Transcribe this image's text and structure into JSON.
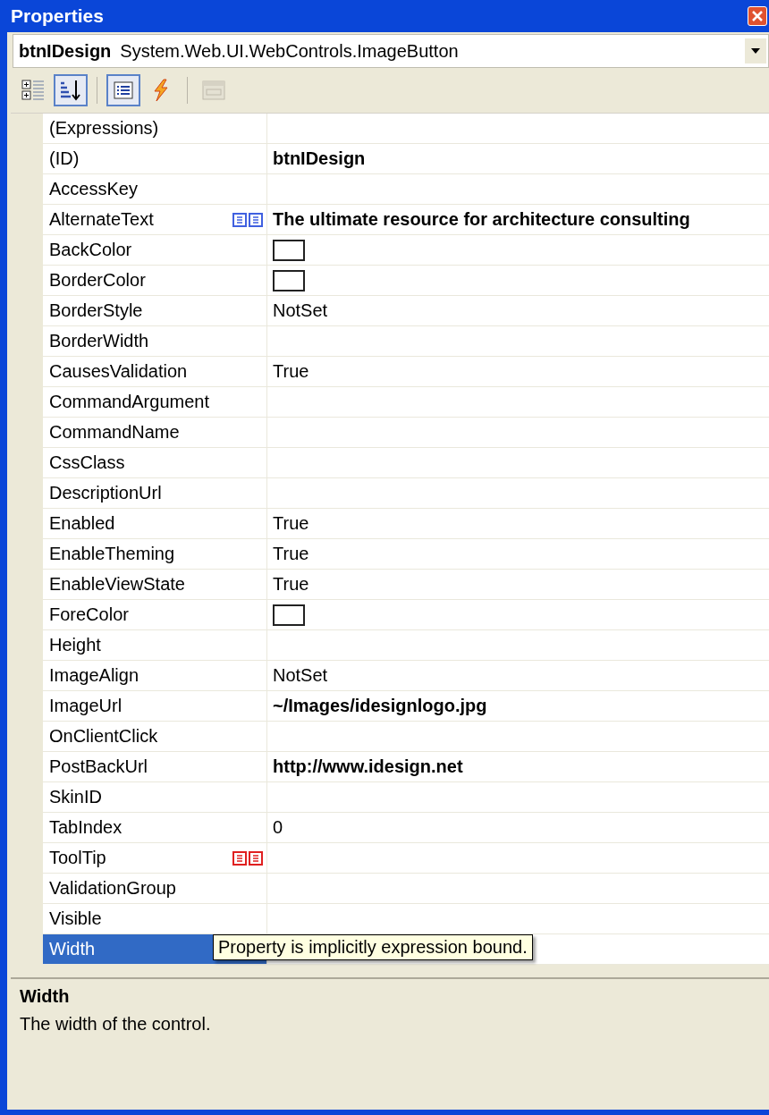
{
  "window": {
    "title": "Properties"
  },
  "object_selector": {
    "name": "btnIDesign",
    "type": "System.Web.UI.WebControls.ImageButton"
  },
  "toolbar": [
    {
      "kind": "categorized",
      "selected": false,
      "disabled": false
    },
    {
      "kind": "alphabetical",
      "selected": true,
      "disabled": false
    },
    {
      "kind": "separator"
    },
    {
      "kind": "properties",
      "selected": true,
      "disabled": false
    },
    {
      "kind": "events",
      "selected": false,
      "disabled": false
    },
    {
      "kind": "separator"
    },
    {
      "kind": "property-pages",
      "selected": false,
      "disabled": true
    }
  ],
  "properties": [
    {
      "name": "(Expressions)",
      "kind": "text",
      "expression_bound": false,
      "implicitly_bound": false,
      "selected": false
    },
    {
      "name": "(ID)",
      "value": "btnIDesign",
      "kind": "text",
      "modified": true,
      "expression_bound": false,
      "implicitly_bound": false,
      "selected": false
    },
    {
      "name": "AccessKey",
      "kind": "text",
      "expression_bound": false,
      "implicitly_bound": false,
      "selected": false
    },
    {
      "name": "AlternateText",
      "value": "The ultimate resource for architecture consulting",
      "kind": "text",
      "modified": true,
      "expression_bound": true,
      "implicitly_bound": false,
      "selected": false
    },
    {
      "name": "BackColor",
      "kind": "color",
      "expression_bound": false,
      "implicitly_bound": false,
      "selected": false
    },
    {
      "name": "BorderColor",
      "kind": "color",
      "expression_bound": false,
      "implicitly_bound": false,
      "selected": false
    },
    {
      "name": "BorderStyle",
      "value": "NotSet",
      "kind": "text",
      "modified": false,
      "expression_bound": false,
      "implicitly_bound": false,
      "selected": false
    },
    {
      "name": "BorderWidth",
      "kind": "text",
      "expression_bound": false,
      "implicitly_bound": false,
      "selected": false
    },
    {
      "name": "CausesValidation",
      "value": "True",
      "kind": "text",
      "modified": false,
      "expression_bound": false,
      "implicitly_bound": false,
      "selected": false
    },
    {
      "name": "CommandArgument",
      "kind": "text",
      "expression_bound": false,
      "implicitly_bound": false,
      "selected": false
    },
    {
      "name": "CommandName",
      "kind": "text",
      "expression_bound": false,
      "implicitly_bound": false,
      "selected": false
    },
    {
      "name": "CssClass",
      "kind": "text",
      "expression_bound": false,
      "implicitly_bound": false,
      "selected": false
    },
    {
      "name": "DescriptionUrl",
      "kind": "text",
      "expression_bound": false,
      "implicitly_bound": false,
      "selected": false
    },
    {
      "name": "Enabled",
      "value": "True",
      "kind": "text",
      "modified": false,
      "expression_bound": false,
      "implicitly_bound": false,
      "selected": false
    },
    {
      "name": "EnableTheming",
      "value": "True",
      "kind": "text",
      "modified": false,
      "expression_bound": false,
      "implicitly_bound": false,
      "selected": false
    },
    {
      "name": "EnableViewState",
      "value": "True",
      "kind": "text",
      "modified": false,
      "expression_bound": false,
      "implicitly_bound": false,
      "selected": false
    },
    {
      "name": "ForeColor",
      "kind": "color",
      "expression_bound": false,
      "implicitly_bound": false,
      "selected": false
    },
    {
      "name": "Height",
      "kind": "text",
      "expression_bound": false,
      "implicitly_bound": false,
      "selected": false
    },
    {
      "name": "ImageAlign",
      "value": "NotSet",
      "kind": "text",
      "modified": false,
      "expression_bound": false,
      "implicitly_bound": false,
      "selected": false
    },
    {
      "name": "ImageUrl",
      "value": "~/Images/idesignlogo.jpg",
      "kind": "text",
      "modified": true,
      "expression_bound": false,
      "implicitly_bound": false,
      "selected": false
    },
    {
      "name": "OnClientClick",
      "kind": "text",
      "expression_bound": false,
      "implicitly_bound": false,
      "selected": false
    },
    {
      "name": "PostBackUrl",
      "value": "http://www.idesign.net",
      "kind": "text",
      "modified": true,
      "expression_bound": false,
      "implicitly_bound": false,
      "selected": false
    },
    {
      "name": "SkinID",
      "kind": "text",
      "expression_bound": false,
      "implicitly_bound": false,
      "selected": false
    },
    {
      "name": "TabIndex",
      "value": "0",
      "kind": "text",
      "modified": false,
      "expression_bound": false,
      "implicitly_bound": false,
      "selected": false
    },
    {
      "name": "ToolTip",
      "kind": "text",
      "expression_bound": false,
      "implicitly_bound": true,
      "selected": false
    },
    {
      "name": "ValidationGroup",
      "kind": "text",
      "expression_bound": false,
      "implicitly_bound": false,
      "selected": false
    },
    {
      "name": "Visible",
      "kind": "text",
      "expression_bound": false,
      "implicitly_bound": false,
      "selected": false
    },
    {
      "name": "Width",
      "kind": "text",
      "expression_bound": false,
      "implicitly_bound": false,
      "selected": true
    }
  ],
  "tooltip": {
    "text": "Property is implicitly expression bound."
  },
  "description": {
    "title": "Width",
    "text": "The width of the control."
  }
}
